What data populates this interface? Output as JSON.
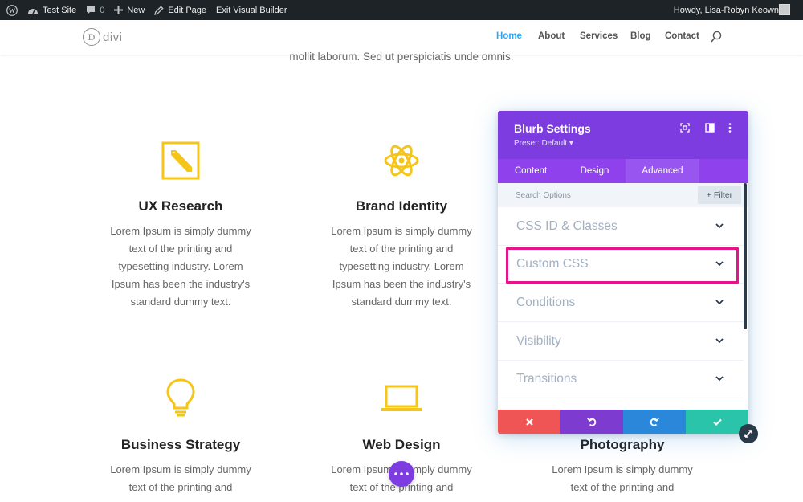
{
  "adminbar": {
    "site_name": "Test Site",
    "comments_count": "0",
    "new_label": "New",
    "edit_label": "Edit Page",
    "exit_label": "Exit Visual Builder",
    "howdy": "Howdy, Lisa-Robyn Keown"
  },
  "header": {
    "logo_letter": "D",
    "logo_text": "divi",
    "nav": [
      "Home",
      "About",
      "Services",
      "Blog",
      "Contact"
    ],
    "active_nav": "Home"
  },
  "intro_text": "mollit laborum. Sed ut perspiciatis unde omnis.",
  "blurbs": [
    {
      "icon": "pencil-square-icon",
      "title": "UX Research",
      "lines": [
        "Lorem Ipsum is simply dummy",
        "text of the printing and",
        "typesetting industry. Lorem",
        "Ipsum has been the industry's",
        "standard dummy text."
      ]
    },
    {
      "icon": "atom-icon",
      "title": "Brand Identity",
      "lines": [
        "Lorem Ipsum is simply dummy",
        "text of the printing and",
        "typesetting industry. Lorem",
        "Ipsum has been the industry's",
        "standard dummy text."
      ]
    },
    {
      "icon": "lightbulb-icon",
      "title": "Business Strategy",
      "lines": [
        "Lorem Ipsum is simply dummy",
        "text of the printing and"
      ]
    },
    {
      "icon": "laptop-icon",
      "title": "Web Design",
      "lines": [
        "Lorem Ipsum is simply dummy",
        "text of the printing and"
      ]
    },
    {
      "icon": "",
      "title": "Photography",
      "lines": [
        "Lorem Ipsum is simply dummy",
        "text of the printing and"
      ]
    }
  ],
  "modal": {
    "title": "Blurb Settings",
    "preset": "Preset: Default ▾",
    "tabs": [
      "Content",
      "Design",
      "Advanced"
    ],
    "active_tab": "Advanced",
    "search_placeholder": "Search Options",
    "filter_label": "+ Filter",
    "sections": [
      "CSS ID & Classes",
      "Custom CSS",
      "Conditions",
      "Visibility",
      "Transitions"
    ],
    "highlighted_section": "Custom CSS",
    "footer_buttons": [
      {
        "name": "discard",
        "icon": "close-icon",
        "color": "#ef5555"
      },
      {
        "name": "undo",
        "icon": "undo-icon",
        "color": "#7e3bd0"
      },
      {
        "name": "redo",
        "icon": "redo-icon",
        "color": "#2b87da"
      },
      {
        "name": "save",
        "icon": "check-icon",
        "color": "#29c4a9"
      }
    ]
  },
  "colors": {
    "accent_purple": "#7d3ce0",
    "highlight_pink": "#e5148b",
    "icon_yellow": "#f5c518",
    "nav_active": "#2ea3f2"
  }
}
